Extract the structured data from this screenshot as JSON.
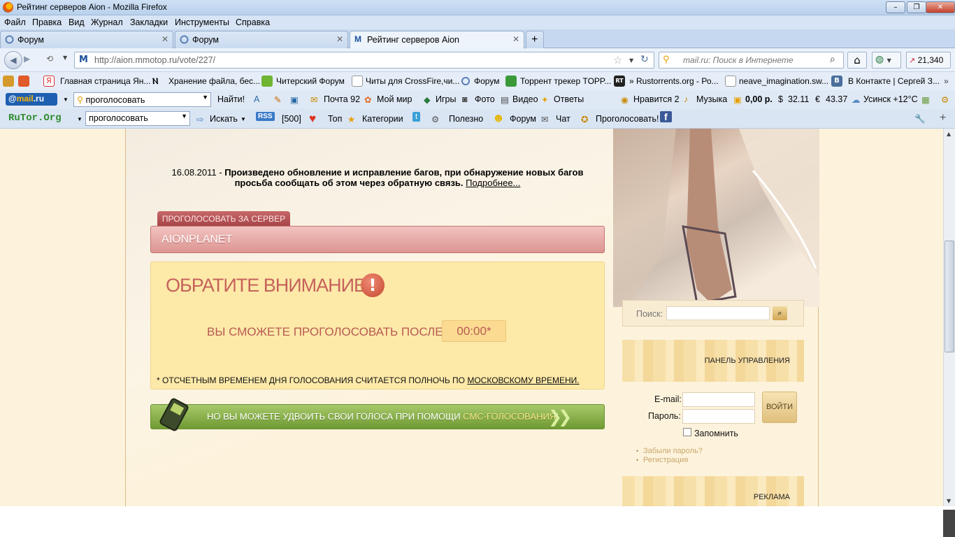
{
  "window": {
    "title": "Рейтинг серверов Aion - Mozilla Firefox"
  },
  "menu": [
    "Файл",
    "Правка",
    "Вид",
    "Журнал",
    "Закладки",
    "Инструменты",
    "Справка"
  ],
  "tabs": [
    {
      "label": "Форум"
    },
    {
      "label": "Форум"
    },
    {
      "label": "Рейтинг серверов Aion"
    }
  ],
  "nav": {
    "url": "http://aion.mmotop.ru/vote/227/",
    "search_placeholder": "mail.ru: Поиск в Интернете",
    "counter": "21,340"
  },
  "bookmarks": [
    "Главная страница Ян...",
    "Хранение файла, бес...",
    "Читерский Форум",
    "Читы для CrossFire,чи...",
    "Форум",
    "Торрент трекер TOPP...",
    "» Rustorrents.org - Ро...",
    "neave_imagination.sw...",
    "В Контакте | Сергей З..."
  ],
  "mailbar": {
    "search_value": "проголосовать",
    "find": "Найти!",
    "mail": "Почта 92",
    "myworld": "Мой мир",
    "games": "Игры",
    "photo": "Фото",
    "video": "Видео",
    "answers": "Ответы",
    "likes": "Нравится 2",
    "music": "Музыка",
    "money": "0,00 р.",
    "usd": "32.11",
    "eur": "43.37",
    "weather": "Усинск +12°C"
  },
  "rutorbar": {
    "logo": "RuTor.Org",
    "search_value": "проголосовать",
    "search": "Искать",
    "count": "[500]",
    "top": "Топ",
    "categories": "Категории",
    "useful": "Полезно",
    "forum": "Форум",
    "chat": "Чат",
    "vote": "Проголосовать!"
  },
  "page": {
    "news_date": "16.08.2011 -",
    "news_text": "Произведено обновление и исправление багов, при обнаружение новых багов просьба сообщать об этом через обратную связь.",
    "news_more": "Подробнее...",
    "vote_tab": "ПРОГОЛОСОВАТЬ ЗА СЕРВЕР",
    "server_name": "AIONPLANET",
    "notice_title": "ОБРАТИТЕ ВНИМАНИЕ",
    "notice_after": "ВЫ СМОЖЕТЕ ПРОГОЛОСОВАТЬ ПОСЛЕ",
    "timer": "00:00*",
    "footnote": "* ОТСЧЕТНЫМ ВРЕМЕНЕМ ДНЯ ГОЛОСОВАНИЯ СЧИТАЕТСЯ ПОЛНОЧЬ ПО",
    "footnote_link": "МОСКОВСКОМУ ВРЕМЕНИ.",
    "sms_text": "НО ВЫ МОЖЕТЕ УДВОИТЬ СВОИ ГОЛОСА ПРИ ПОМОЩИ",
    "sms_link": "СМС-ГОЛОСОВАНИЯ",
    "sms_end": "!"
  },
  "sidebar": {
    "search_label": "Поиск:",
    "panel_title": "ПАНЕЛЬ УПРАВЛЕНИЯ",
    "email_label": "E-mail:",
    "password_label": "Пароль:",
    "login_button": "ВОЙТИ",
    "remember": "Запомнить",
    "forgot": "Забыли пароль?",
    "register": "Регистрация",
    "ads_title": "РЕКЛАМА"
  }
}
